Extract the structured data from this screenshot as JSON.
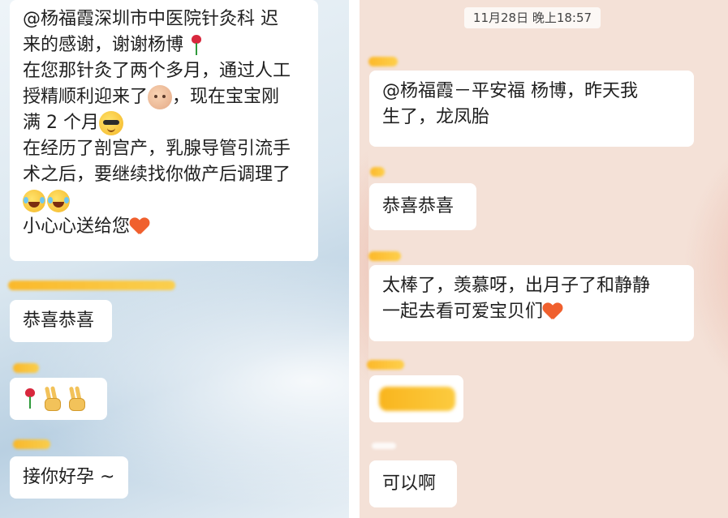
{
  "left_chat": {
    "messages": [
      {
        "lines": [
          "@杨福霞深圳市中医院针灸科  迟",
          "来的感谢，谢谢杨博",
          "在您那针灸了两个多月，通过人工",
          "授精顺利迎来了",
          "，现在宝宝刚",
          "满 2 个月",
          "在经历了剖宫产，乳腺导管引流手",
          "术之后，要继续找你做产后调理了",
          "小心心送给您"
        ],
        "icons": [
          "rose-icon",
          "baby-face-icon",
          "cool-face-icon",
          "tears-of-joy-icon",
          "heart-icon"
        ]
      },
      {
        "text": "恭喜恭喜"
      },
      {
        "icons": [
          "rose-icon",
          "victory-hand-icon",
          "victory-hand-icon"
        ]
      },
      {
        "text": "接你好孕 ~"
      }
    ]
  },
  "right_chat": {
    "timestamp": "11月28日 晚上18:57",
    "messages": [
      {
        "lines": [
          "@杨福霞－平安福  杨博，昨天我",
          "生了，龙凤胎"
        ]
      },
      {
        "text": "恭喜恭喜"
      },
      {
        "lines": [
          "太棒了，羡慕呀，出月子了和静静",
          "一起去看可爱宝贝们"
        ],
        "icons": [
          "heart-icon"
        ]
      },
      {
        "text": ""
      },
      {
        "text": "可以啊"
      }
    ]
  },
  "colors": {
    "bubble": "#ffffff",
    "redaction": "#fcb620",
    "left_background": "#cfdfeb",
    "right_background": "#f4e1d7"
  }
}
